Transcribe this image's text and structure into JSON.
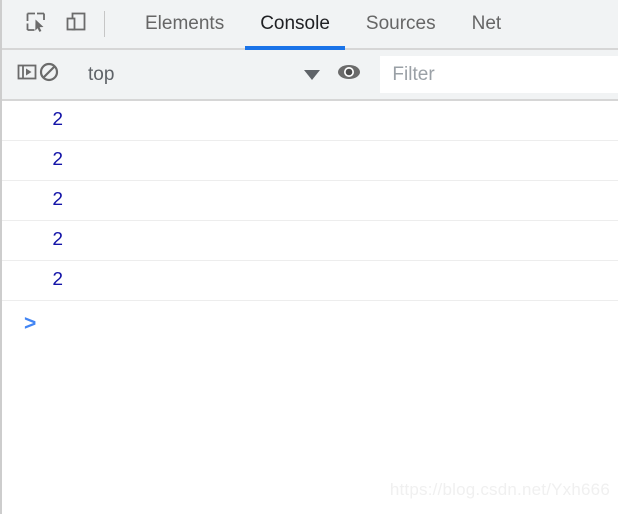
{
  "window": {
    "title": "Chrome DevTools Console"
  },
  "tabbar": {
    "inspect_icon": "inspect-element-icon",
    "device_icon": "device-toolbar-icon",
    "tabs": [
      {
        "label": "Elements",
        "active": false
      },
      {
        "label": "Console",
        "active": true
      },
      {
        "label": "Sources",
        "active": false
      },
      {
        "label": "Net",
        "active": false
      }
    ],
    "active_underline_color": "#1a73e8"
  },
  "console_toolbar": {
    "sidebar_toggle_icon": "console-sidebar-icon",
    "clear_icon": "clear-console-icon",
    "context": {
      "value": "top",
      "chevron_icon": "chevron-down-icon"
    },
    "eye_icon": "live-expression-eye-icon",
    "filter": {
      "value": "",
      "placeholder": "Filter"
    }
  },
  "console_output": {
    "rows": [
      {
        "value": "2"
      },
      {
        "value": "2"
      },
      {
        "value": "2"
      },
      {
        "value": "2"
      },
      {
        "value": "2"
      }
    ],
    "value_color": "#1414a8",
    "prompt": ">"
  },
  "watermark": {
    "text": "https://blog.csdn.net/Yxh666"
  }
}
